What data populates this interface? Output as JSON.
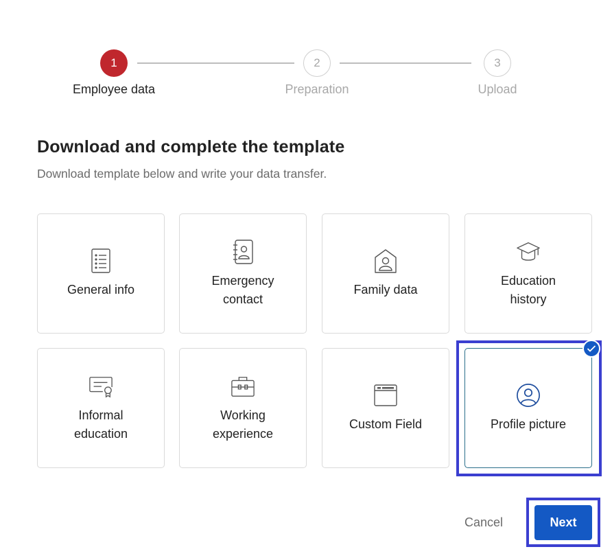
{
  "stepper": {
    "steps": [
      {
        "number": "1",
        "label": "Employee data",
        "state": "active"
      },
      {
        "number": "2",
        "label": "Preparation",
        "state": "inactive"
      },
      {
        "number": "3",
        "label": "Upload",
        "state": "inactive"
      }
    ]
  },
  "header": {
    "title": "Download and complete the template",
    "subtitle": "Download template below and write your data transfer."
  },
  "templates": [
    {
      "label": "General info",
      "icon": "document-list-icon",
      "selected": false
    },
    {
      "label": "Emergency contact",
      "icon": "contact-book-icon",
      "selected": false
    },
    {
      "label": "Family data",
      "icon": "house-person-icon",
      "selected": false
    },
    {
      "label": "Education history",
      "icon": "graduation-cap-icon",
      "selected": false
    },
    {
      "label": "Informal education",
      "icon": "certificate-icon",
      "selected": false
    },
    {
      "label": "Working experience",
      "icon": "briefcase-icon",
      "selected": false
    },
    {
      "label": "Custom Field",
      "icon": "window-icon",
      "selected": false
    },
    {
      "label": "Profile picture",
      "icon": "user-circle-icon",
      "selected": true
    }
  ],
  "actions": {
    "cancel_label": "Cancel",
    "next_label": "Next"
  },
  "colors": {
    "active_step": "#c0272d",
    "primary": "#1459c4",
    "highlight": "#3b3fd0"
  }
}
